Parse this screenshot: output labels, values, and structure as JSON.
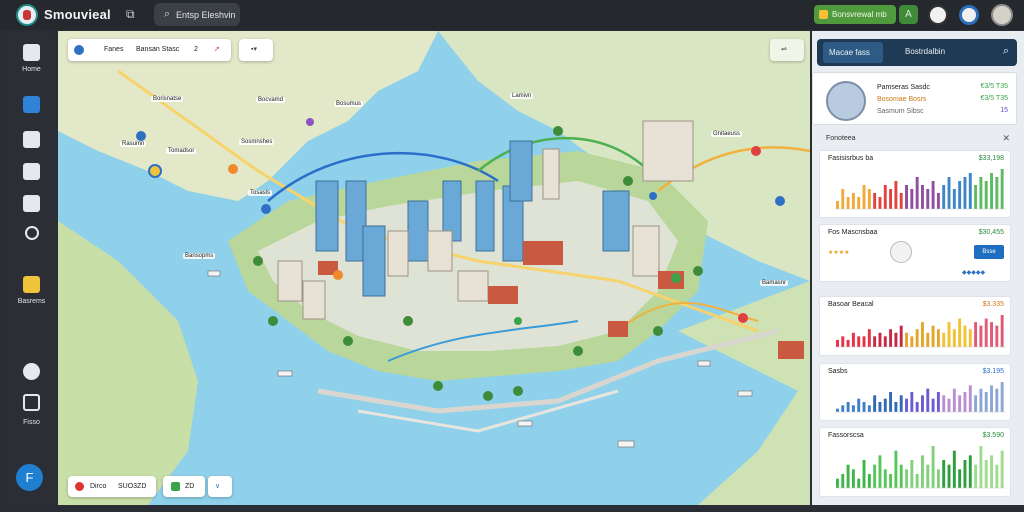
{
  "app": {
    "title": "Smouvieal",
    "search_placeholder": "Entsp Eleshvin"
  },
  "topbar": {
    "pill_label": "Bonsvrewal mb",
    "pill_icon": "A"
  },
  "sidebar": {
    "items": [
      {
        "label": "Home"
      },
      {
        "label": ""
      },
      {
        "label": ""
      },
      {
        "label": ""
      },
      {
        "label": ""
      },
      {
        "label": ""
      },
      {
        "label": "Basrems"
      },
      {
        "label": ""
      },
      {
        "label": ""
      },
      {
        "label": "Fisso"
      }
    ],
    "fab_label": "F"
  },
  "map": {
    "search_label": "Fanes",
    "search_value": "Bansan Stasc",
    "toggle_label": "2",
    "bottom_left_label": "Dirco",
    "bottom_left_value": "SUO3ZD",
    "bottom_mid_label": "ZD",
    "place_labels": [
      "Borisnatse",
      "Bocvamd",
      "Rasumn",
      "Tomadsor",
      "Sosmnshes",
      "Tosasls",
      "Bosumus",
      "Lamivn",
      "Gnitaeuss",
      "Bamasnr",
      "Bansopms"
    ]
  },
  "panel": {
    "tabs": [
      "Macae fass",
      "Bostrdalbin"
    ],
    "profile": {
      "name": "Pamseras Sasdc",
      "role": "Bosomae Bosrs",
      "sub": "Sasmum Sibsc",
      "stat1": "€3/5 T35",
      "stat2": "€3/5 T35",
      "stat3": "15"
    },
    "section_title": "Fonoteea",
    "cards": [
      {
        "title": "Fasisisrbus ba",
        "value": "$33,198",
        "colors": [
          "#f0a93a",
          "#e0443e",
          "#8f4f9d",
          "#3f86c7",
          "#5dbb63"
        ]
      },
      {
        "title": "Fos Mascnsbaa",
        "value": "$30,455",
        "button": "Bsse"
      },
      {
        "title": "Basoar Beacal",
        "value": "$3.335",
        "colors": [
          "#e53244",
          "#c42a45",
          "#e5a52b",
          "#f1c232",
          "#e15b74"
        ]
      },
      {
        "title": "Sasbs",
        "value": "$3.195",
        "colors": [
          "#3f7ec9",
          "#2f6bb3",
          "#6f5bd1",
          "#b98fd1",
          "#8ba7d8"
        ]
      },
      {
        "title": "Fassorscsa",
        "value": "$3.590",
        "colors": [
          "#3fb54a",
          "#58c55b",
          "#81d17b",
          "#2f9e3e",
          "#9fdc8f"
        ]
      }
    ]
  },
  "chart_data": [
    {
      "type": "bar",
      "title": "Fasisisrbus ba",
      "values": [
        2,
        5,
        3,
        4,
        3,
        6,
        5,
        4,
        3,
        6,
        5,
        7,
        4,
        6,
        5,
        8,
        6,
        5,
        7,
        4,
        6,
        8,
        5,
        7,
        8,
        9,
        6,
        8,
        7,
        9,
        8,
        10
      ]
    },
    {
      "type": "bar",
      "title": "Basoar Beacal",
      "values": [
        2,
        3,
        2,
        4,
        3,
        3,
        5,
        3,
        4,
        3,
        5,
        4,
        6,
        4,
        3,
        5,
        7,
        4,
        6,
        5,
        4,
        7,
        5,
        8,
        6,
        5,
        7,
        6,
        8,
        7,
        6,
        9
      ]
    },
    {
      "type": "bar",
      "title": "Sasbs",
      "values": [
        1,
        2,
        3,
        2,
        4,
        3,
        2,
        5,
        3,
        4,
        6,
        3,
        5,
        4,
        6,
        3,
        5,
        7,
        4,
        6,
        5,
        4,
        7,
        5,
        6,
        8,
        5,
        7,
        6,
        8,
        7,
        9
      ]
    },
    {
      "type": "bar",
      "title": "Fassorscsa",
      "values": [
        2,
        3,
        5,
        4,
        2,
        6,
        3,
        5,
        7,
        4,
        3,
        8,
        5,
        4,
        6,
        3,
        7,
        5,
        9,
        4,
        6,
        5,
        8,
        4,
        6,
        7,
        5,
        9,
        6,
        7,
        5,
        8
      ]
    }
  ]
}
